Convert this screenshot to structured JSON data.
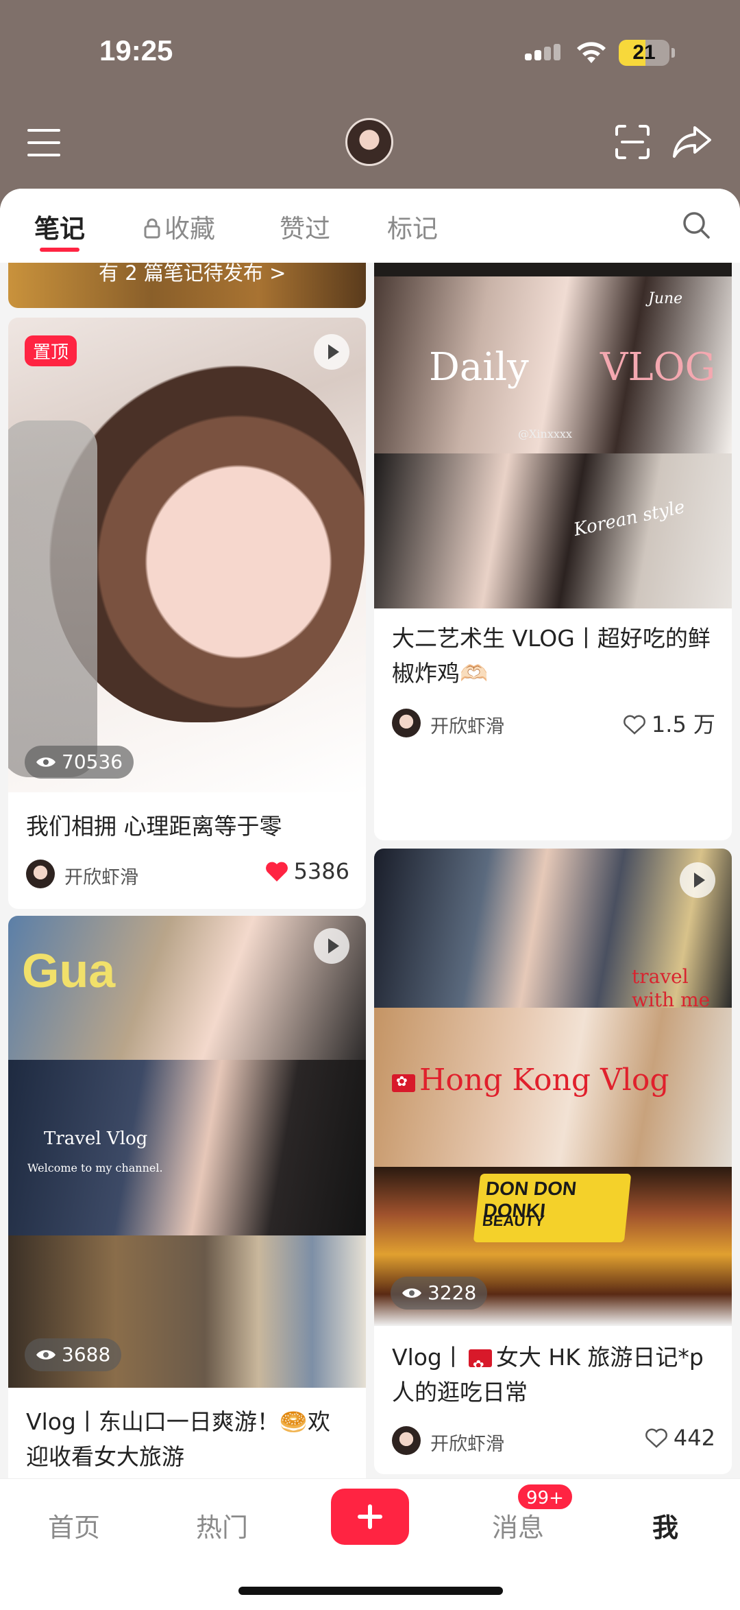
{
  "status_bar": {
    "time": "19:25",
    "battery": "21",
    "battery_level": 0.21
  },
  "header": {
    "menu_icon": "hamburger-menu-icon",
    "scan_icon": "scan-icon",
    "share_icon": "share-arrow-icon"
  },
  "tabs": {
    "notes": "笔记",
    "collections": "收藏",
    "liked": "赞过",
    "tagged": "标记"
  },
  "drafts_banner": {
    "label": "有 2 篇笔记待发布 >"
  },
  "cards": {
    "pinned": {
      "badge": "置顶",
      "views": "70536",
      "title": "我们相拥 心理距离等于零",
      "author": "开欣虾滑",
      "likes": "5386",
      "liked": true
    },
    "daily_vlog": {
      "overlay_daily": "Daily",
      "overlay_vlog": "VLOG",
      "overlay_handle": "@Xinxxxx",
      "overlay_june": "June",
      "overlay_korean": "Korean style",
      "title": "大二艺术生 VLOG丨超好吃的鲜椒炸鸡🫶🏻",
      "author": "开欣虾滑",
      "likes": "1.5 万"
    },
    "travel_vlog": {
      "overlay_gua": "Gua",
      "overlay_travel": "Travel Vlog",
      "overlay_welcome": "Welcome to my channel.",
      "views": "3688",
      "title_part1": "Vlog丨东山口一日爽游！🥯欢迎收看女大旅游"
    },
    "hk_vlog": {
      "overlay_travel_with_me": "travel with me",
      "overlay_hongkong": "Hong Kong Vlog",
      "overlay_sign": "DON DON DONKI",
      "overlay_sign_sub": "BEAUTY",
      "views": "3228",
      "title_prefix": "Vlog丨",
      "title_rest": "女大 HK 旅游日记*p人的逛吃日常",
      "author": "开欣虾滑",
      "likes": "442"
    }
  },
  "bottom_nav": {
    "home": "首页",
    "hot": "热门",
    "messages": "消息",
    "messages_badge": "99+",
    "me": "我"
  }
}
